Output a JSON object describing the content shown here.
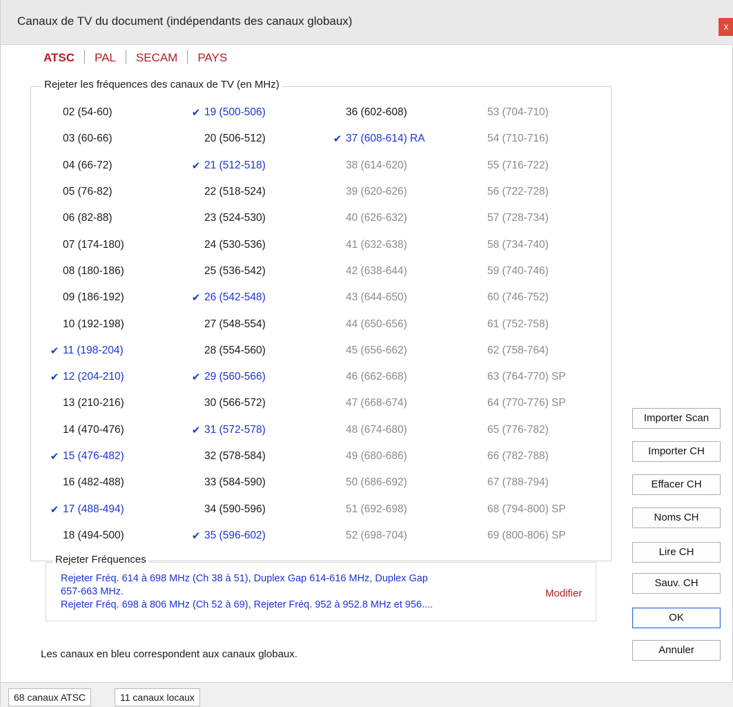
{
  "window": {
    "title": "Canaux de TV du document (indépendants des canaux globaux)",
    "close_label": "x"
  },
  "tabs": [
    {
      "label": "ATSC",
      "active": true
    },
    {
      "label": "PAL",
      "active": false
    },
    {
      "label": "SECAM",
      "active": false
    },
    {
      "label": "PAYS",
      "active": false
    }
  ],
  "channels_group": {
    "legend": "Rejeter les fréquences des canaux de TV (en MHz)",
    "checkmark": "✔",
    "channels": [
      {
        "label": "02 (54-60)",
        "state": "normal",
        "checked": false
      },
      {
        "label": "03 (60-66)",
        "state": "normal",
        "checked": false
      },
      {
        "label": "04 (66-72)",
        "state": "normal",
        "checked": false
      },
      {
        "label": "05 (76-82)",
        "state": "normal",
        "checked": false
      },
      {
        "label": "06 (82-88)",
        "state": "normal",
        "checked": false
      },
      {
        "label": "07 (174-180)",
        "state": "normal",
        "checked": false
      },
      {
        "label": "08 (180-186)",
        "state": "normal",
        "checked": false
      },
      {
        "label": "09 (186-192)",
        "state": "normal",
        "checked": false
      },
      {
        "label": "10 (192-198)",
        "state": "normal",
        "checked": false
      },
      {
        "label": "11 (198-204)",
        "state": "global",
        "checked": true
      },
      {
        "label": "12 (204-210)",
        "state": "global",
        "checked": true
      },
      {
        "label": "13 (210-216)",
        "state": "normal",
        "checked": false
      },
      {
        "label": "14 (470-476)",
        "state": "normal",
        "checked": false
      },
      {
        "label": "15 (476-482)",
        "state": "global",
        "checked": true
      },
      {
        "label": "16 (482-488)",
        "state": "normal",
        "checked": false
      },
      {
        "label": "17 (488-494)",
        "state": "global",
        "checked": true
      },
      {
        "label": "18 (494-500)",
        "state": "normal",
        "checked": false
      },
      {
        "label": "19 (500-506)",
        "state": "global",
        "checked": true
      },
      {
        "label": "20 (506-512)",
        "state": "normal",
        "checked": false
      },
      {
        "label": "21 (512-518)",
        "state": "global",
        "checked": true
      },
      {
        "label": "22 (518-524)",
        "state": "normal",
        "checked": false
      },
      {
        "label": "23 (524-530)",
        "state": "normal",
        "checked": false
      },
      {
        "label": "24 (530-536)",
        "state": "normal",
        "checked": false
      },
      {
        "label": "25 (536-542)",
        "state": "normal",
        "checked": false
      },
      {
        "label": "26 (542-548)",
        "state": "global",
        "checked": true
      },
      {
        "label": "27 (548-554)",
        "state": "normal",
        "checked": false
      },
      {
        "label": "28 (554-560)",
        "state": "normal",
        "checked": false
      },
      {
        "label": "29 (560-566)",
        "state": "global",
        "checked": true
      },
      {
        "label": "30 (566-572)",
        "state": "normal",
        "checked": false
      },
      {
        "label": "31 (572-578)",
        "state": "global",
        "checked": true
      },
      {
        "label": "32 (578-584)",
        "state": "normal",
        "checked": false
      },
      {
        "label": "33 (584-590)",
        "state": "normal",
        "checked": false
      },
      {
        "label": "34 (590-596)",
        "state": "normal",
        "checked": false
      },
      {
        "label": "35 (596-602)",
        "state": "global",
        "checked": true
      },
      {
        "label": "36 (602-608)",
        "state": "normal",
        "checked": false
      },
      {
        "label": "37 (608-614) RA",
        "state": "global",
        "checked": true
      },
      {
        "label": "38 (614-620)",
        "state": "rejected",
        "checked": false
      },
      {
        "label": "39 (620-626)",
        "state": "rejected",
        "checked": false
      },
      {
        "label": "40 (626-632)",
        "state": "rejected",
        "checked": false
      },
      {
        "label": "41 (632-638)",
        "state": "rejected",
        "checked": false
      },
      {
        "label": "42 (638-644)",
        "state": "rejected",
        "checked": false
      },
      {
        "label": "43 (644-650)",
        "state": "rejected",
        "checked": false
      },
      {
        "label": "44 (650-656)",
        "state": "rejected",
        "checked": false
      },
      {
        "label": "45 (656-662)",
        "state": "rejected",
        "checked": false
      },
      {
        "label": "46 (662-668)",
        "state": "rejected",
        "checked": false
      },
      {
        "label": "47 (668-674)",
        "state": "rejected",
        "checked": false
      },
      {
        "label": "48 (674-680)",
        "state": "rejected",
        "checked": false
      },
      {
        "label": "49 (680-686)",
        "state": "rejected",
        "checked": false
      },
      {
        "label": "50 (686-692)",
        "state": "rejected",
        "checked": false
      },
      {
        "label": "51 (692-698)",
        "state": "rejected",
        "checked": false
      },
      {
        "label": "52 (698-704)",
        "state": "rejected",
        "checked": false
      },
      {
        "label": "53 (704-710)",
        "state": "rejected",
        "checked": false
      },
      {
        "label": "54 (710-716)",
        "state": "rejected",
        "checked": false
      },
      {
        "label": "55 (716-722)",
        "state": "rejected",
        "checked": false
      },
      {
        "label": "56 (722-728)",
        "state": "rejected",
        "checked": false
      },
      {
        "label": "57 (728-734)",
        "state": "rejected",
        "checked": false
      },
      {
        "label": "58 (734-740)",
        "state": "rejected",
        "checked": false
      },
      {
        "label": "59 (740-746)",
        "state": "rejected",
        "checked": false
      },
      {
        "label": "60 (746-752)",
        "state": "rejected",
        "checked": false
      },
      {
        "label": "61 (752-758)",
        "state": "rejected",
        "checked": false
      },
      {
        "label": "62 (758-764)",
        "state": "rejected",
        "checked": false
      },
      {
        "label": "63 (764-770) SP",
        "state": "rejected",
        "checked": false
      },
      {
        "label": "64 (770-776) SP",
        "state": "rejected",
        "checked": false
      },
      {
        "label": "65 (776-782)",
        "state": "rejected",
        "checked": false
      },
      {
        "label": "66 (782-788)",
        "state": "rejected",
        "checked": false
      },
      {
        "label": "67 (788-794)",
        "state": "rejected",
        "checked": false
      },
      {
        "label": "68 (794-800) SP",
        "state": "rejected",
        "checked": false
      },
      {
        "label": "69 (800-806) SP",
        "state": "rejected",
        "checked": false
      }
    ]
  },
  "reject_group": {
    "legend": "Rejeter Fréquences",
    "lines": [
      "Rejeter Fréq. 614 à 698 MHz (Ch 38 à 51), Duplex Gap 614-616 MHz, Duplex Gap",
      "657-663 MHz.",
      "Rejeter Fréq. 698 à 806 MHz (Ch 52 à 69), Rejeter Fréq. 952 à 952.8 MHz et 956...."
    ],
    "modify_label": "Modifier"
  },
  "note": "Les canaux en bleu correspondent aux canaux globaux.",
  "buttons": {
    "import_scan": "Importer Scan",
    "import_ch": "Importer CH",
    "clear_ch": "Effacer CH",
    "names_ch": "Noms CH",
    "read_ch": "Lire CH",
    "save_ch": "Sauv. CH",
    "ok": "OK",
    "cancel": "Annuler"
  },
  "statusbar": {
    "atsc_count": "68 canaux ATSC",
    "local_count": "11 canaux locaux"
  },
  "colors": {
    "accent_red": "#b11e22",
    "global_blue": "#1a33d6",
    "rejected_gray": "#8a8a8a"
  }
}
